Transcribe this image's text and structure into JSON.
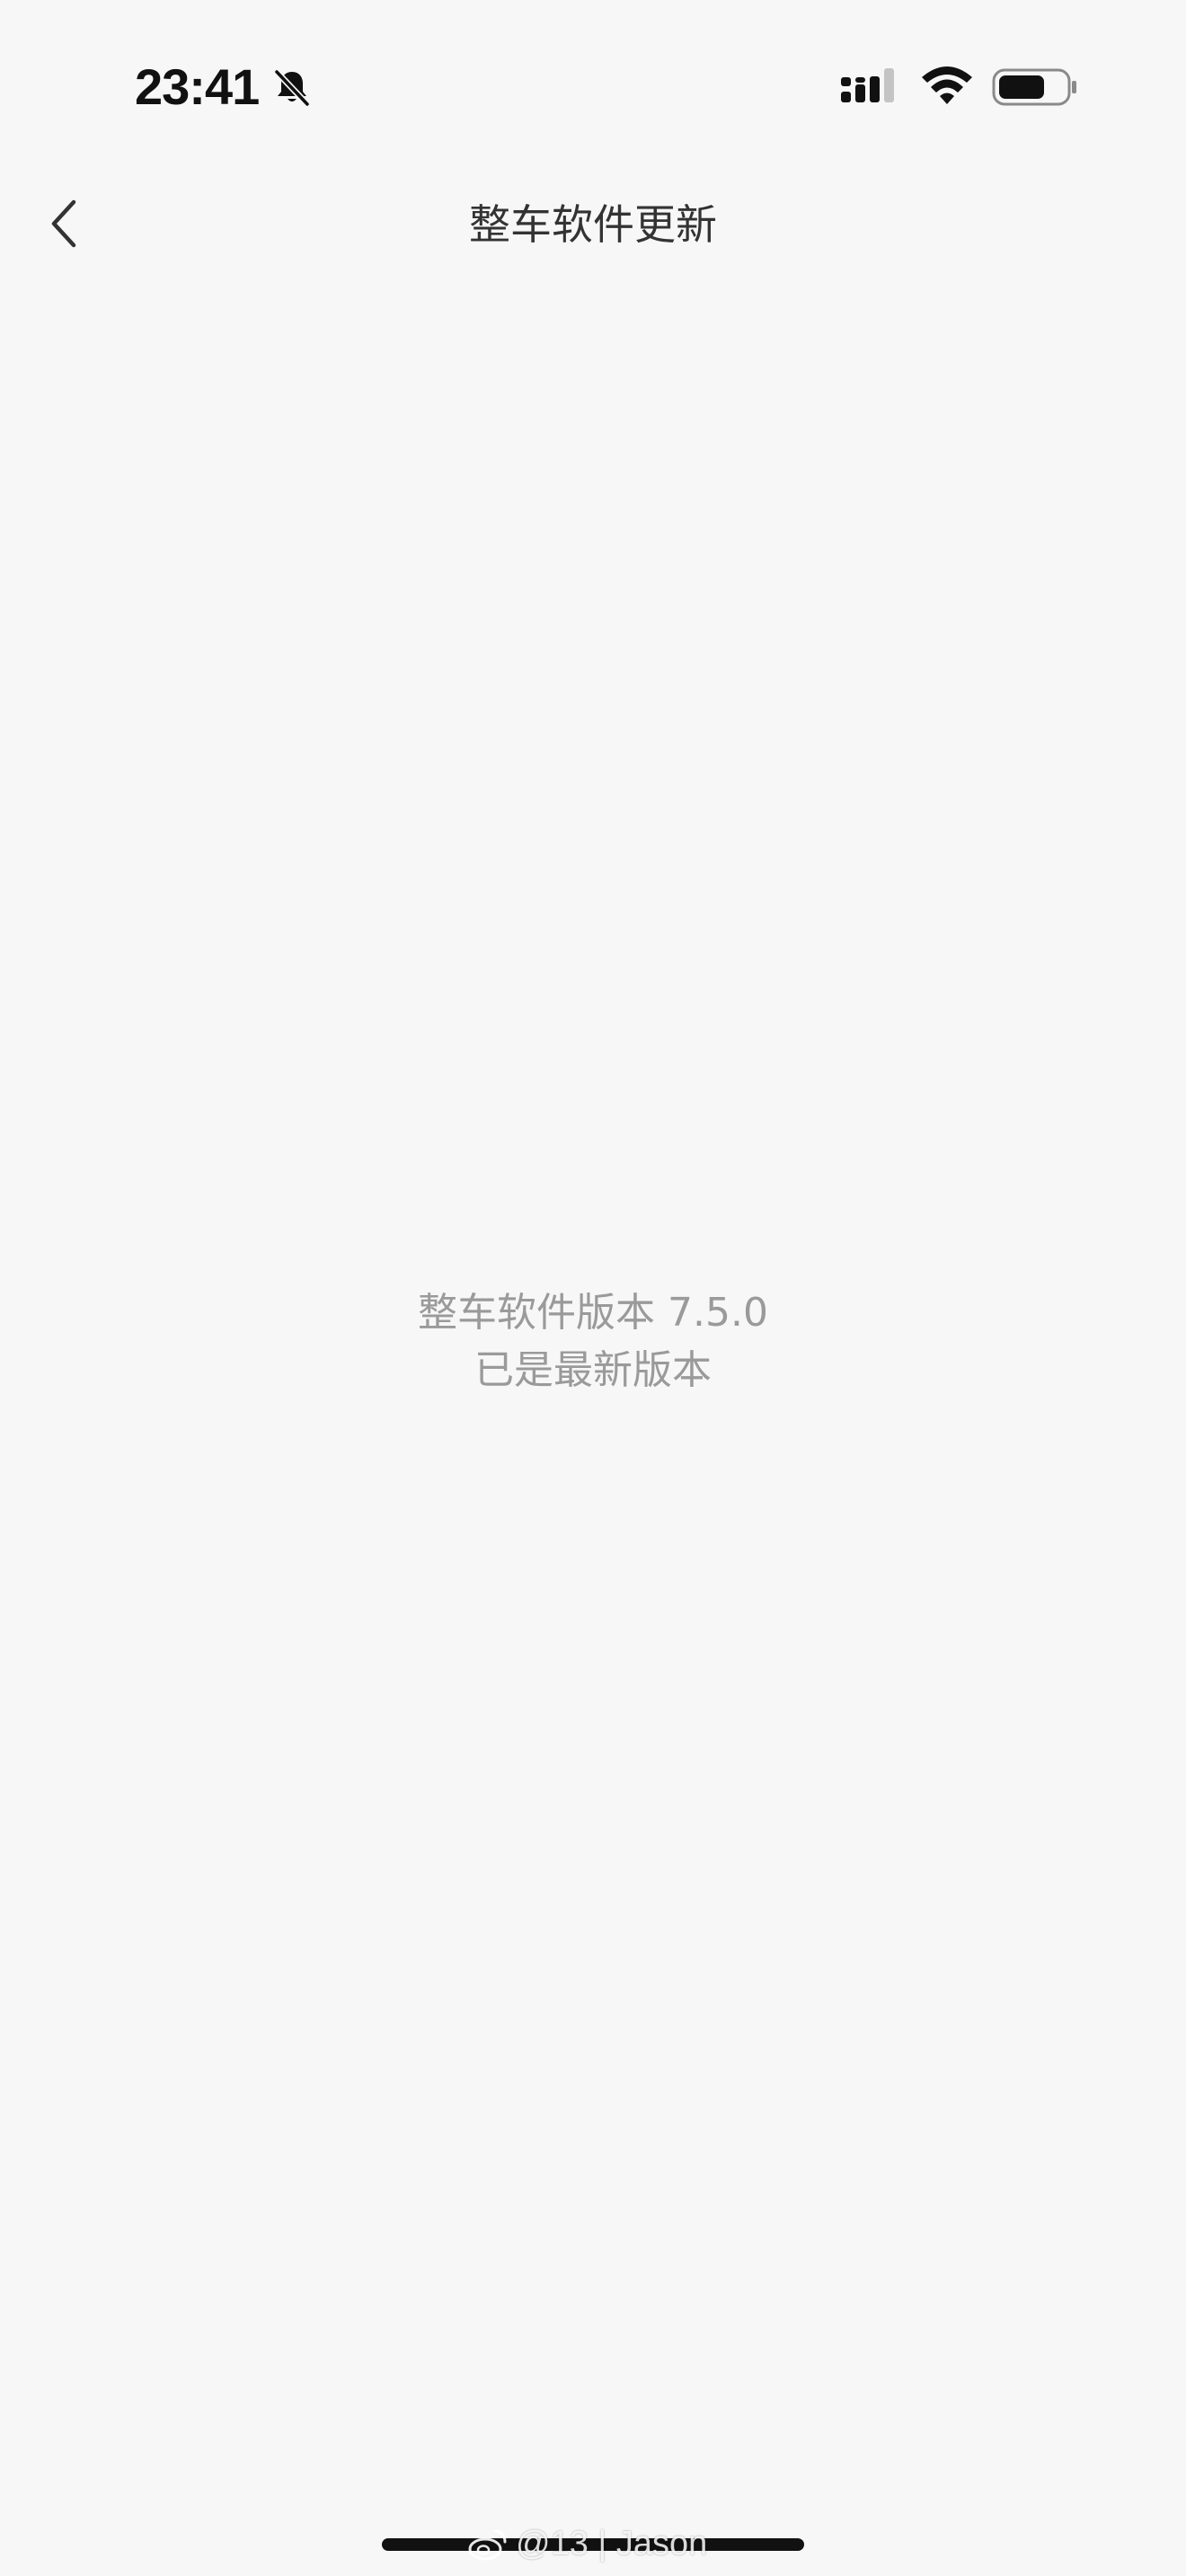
{
  "status_bar": {
    "time": "23:41",
    "icons": [
      "bell-off-icon",
      "signal-icon",
      "wifi-icon",
      "battery-icon"
    ]
  },
  "nav": {
    "title": "整车软件更新",
    "back_icon": "chevron-left-icon"
  },
  "main": {
    "version_line": "整车软件版本 7.5.0",
    "status_line": "已是最新版本"
  },
  "watermark": {
    "text": "@13 | Jason",
    "icon": "weibo-icon"
  },
  "colors": {
    "background": "#f7f7f7",
    "title_text": "#333333",
    "message_text": "#9a9a9a"
  }
}
